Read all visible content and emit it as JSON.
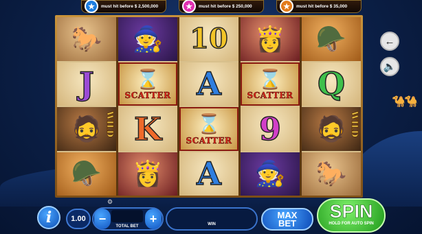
{
  "jackpots": [
    {
      "icon": "star-icon",
      "label": "must hit before $ 2,500,000",
      "color": "#1d7de0"
    },
    {
      "icon": "star-icon",
      "label": "must hit before $ 250,000",
      "color": "#e02fb0"
    },
    {
      "icon": "star-icon",
      "label": "must hit before $ 35,000",
      "color": "#e27a1a"
    }
  ],
  "reels": [
    [
      {
        "kind": "horse",
        "label": "",
        "icon": "white-horse"
      },
      {
        "kind": "letter",
        "label": "J",
        "cls": "LJ"
      },
      {
        "kind": "hero",
        "label": "",
        "icon": "desert-hero",
        "wild": "WILD"
      },
      {
        "kind": "helmet",
        "label": "",
        "icon": "golden-helmet"
      }
    ],
    [
      {
        "kind": "genie",
        "label": "",
        "icon": "old-sorcerer"
      },
      {
        "kind": "scatter",
        "label": "SCATTER",
        "icon": "hourglass"
      },
      {
        "kind": "letter",
        "label": "K",
        "cls": "LK"
      },
      {
        "kind": "lady",
        "label": "",
        "icon": "princess"
      }
    ],
    [
      {
        "kind": "letter",
        "label": "10",
        "cls": "L10"
      },
      {
        "kind": "letter",
        "label": "A",
        "cls": "LA"
      },
      {
        "kind": "scatter",
        "label": "SCATTER",
        "icon": "hourglass"
      },
      {
        "kind": "letter",
        "label": "A",
        "cls": "LA"
      }
    ],
    [
      {
        "kind": "lady",
        "label": "",
        "icon": "princess"
      },
      {
        "kind": "scatter",
        "label": "SCATTER",
        "icon": "hourglass"
      },
      {
        "kind": "letter",
        "label": "9",
        "cls": "L9"
      },
      {
        "kind": "genie",
        "label": "",
        "icon": "old-sorcerer"
      }
    ],
    [
      {
        "kind": "helmet",
        "label": "",
        "icon": "golden-helmet"
      },
      {
        "kind": "letter",
        "label": "Q",
        "cls": "LQ"
      },
      {
        "kind": "hero",
        "label": "",
        "icon": "desert-hero",
        "wild": "WILD"
      },
      {
        "kind": "horse",
        "label": "",
        "icon": "white-horse"
      }
    ]
  ],
  "side_buttons": {
    "back_icon": "arrow-left-icon",
    "sound_icon": "speaker-icon"
  },
  "controls": {
    "info_label": "i",
    "bet_value": "1.00",
    "minus_label": "−",
    "plus_label": "+",
    "total_bet_label": "TOTAL BET",
    "win_label": "WIN",
    "max_bet_line1": "MAX",
    "max_bet_line2": "BET",
    "spin_label": "SPIN",
    "spin_sub": "HOLD FOR AUTO SPIN"
  }
}
